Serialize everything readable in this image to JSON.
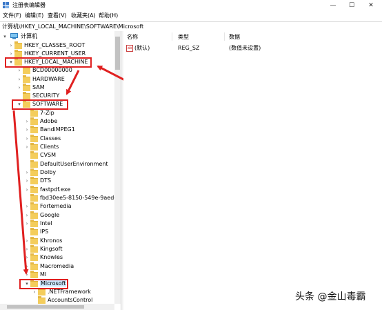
{
  "window": {
    "title": "注册表编辑器",
    "minimize": "—",
    "maximize": "☐",
    "close": "✕"
  },
  "menu": [
    "文件(F)",
    "编辑(E)",
    "查看(V)",
    "收藏夹(A)",
    "帮助(H)"
  ],
  "address": "计算机\\HKEY_LOCAL_MACHINE\\SOFTWARE\\Microsoft",
  "tree": [
    {
      "label": "计算机",
      "chevron": "▾",
      "icon": "computer-icon"
    },
    {
      "label": "HKEY_CLASSES_ROOT",
      "chevron": "›"
    },
    {
      "label": "HKEY_CURRENT_USER",
      "chevron": "›"
    },
    {
      "label": "HKEY_LOCAL_MACHINE",
      "chevron": "▾"
    },
    {
      "label": "BCD00000000",
      "chevron": "›"
    },
    {
      "label": "HARDWARE",
      "chevron": "›"
    },
    {
      "label": "SAM",
      "chevron": "›"
    },
    {
      "label": "SECURITY",
      "chevron": ""
    },
    {
      "label": "SOFTWARE",
      "chevron": "▾"
    },
    {
      "label": "7-Zip",
      "chevron": ""
    },
    {
      "label": "Adobe",
      "chevron": "›"
    },
    {
      "label": "BandiMPEG1",
      "chevron": "›"
    },
    {
      "label": "Classes",
      "chevron": "›"
    },
    {
      "label": "Clients",
      "chevron": "›"
    },
    {
      "label": "CVSM",
      "chevron": ""
    },
    {
      "label": "DefaultUserEnvironment",
      "chevron": ""
    },
    {
      "label": "Dolby",
      "chevron": "›"
    },
    {
      "label": "DTS",
      "chevron": "›"
    },
    {
      "label": "fastpdf.exe",
      "chevron": "›"
    },
    {
      "label": "fbd30ee5-8150-549e-9aed-fd9",
      "chevron": ""
    },
    {
      "label": "Fortemedia",
      "chevron": "›"
    },
    {
      "label": "Google",
      "chevron": "›"
    },
    {
      "label": "Intel",
      "chevron": "›"
    },
    {
      "label": "IPS",
      "chevron": ""
    },
    {
      "label": "Khronos",
      "chevron": "›"
    },
    {
      "label": "Kingsoft",
      "chevron": "›"
    },
    {
      "label": "Knowles",
      "chevron": "›"
    },
    {
      "label": "Macromedia",
      "chevron": "›"
    },
    {
      "label": "MI",
      "chevron": "›"
    },
    {
      "label": "Microsoft",
      "chevron": "▾"
    },
    {
      "label": ".NETFramework",
      "chevron": "›"
    },
    {
      "label": "AccountsControl",
      "chevron": ""
    }
  ],
  "list": {
    "headers": {
      "name": "名称",
      "type": "类型",
      "data": "数据"
    },
    "rows": [
      {
        "icon": "ab",
        "name": "(默认)",
        "type": "REG_SZ",
        "data": "(数值未设置)"
      }
    ]
  },
  "watermark": "头条 @金山毒霸",
  "colors": {
    "highlight": "#e02020",
    "folder": "#f4cd5c",
    "selection": "#cce8ff"
  }
}
